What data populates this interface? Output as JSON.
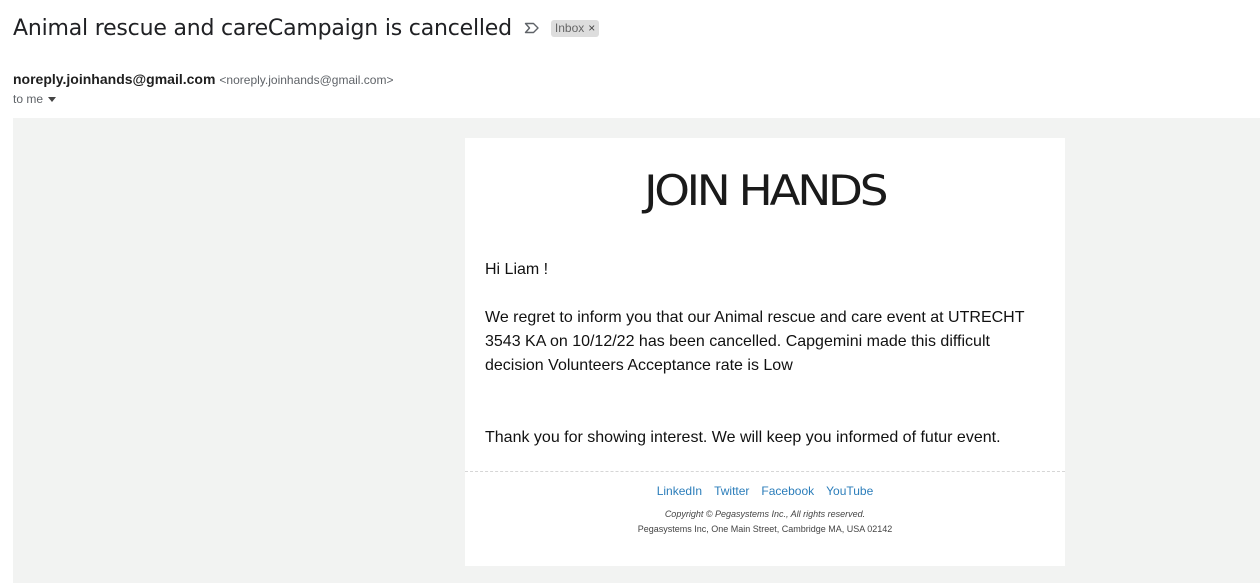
{
  "email": {
    "subject": "Animal rescue and careCampaign is cancelled",
    "label": "Inbox",
    "label_remove": "×",
    "sender_name": "noreply.joinhands@gmail.com",
    "sender_email": "<noreply.joinhands@gmail.com>",
    "recipient": "to me"
  },
  "content": {
    "logo_text": "JOIN HANDS",
    "greeting": "Hi Liam !",
    "paragraph": "We regret to inform you that our Animal rescue and care event at UTRECHT 3543 KA on 10/12/22 has been cancelled. Capgemini made this difficult decision Volunteers Acceptance rate is Low",
    "closing": "Thank you for showing interest. We will keep you informed of futur event."
  },
  "footer": {
    "links": [
      "LinkedIn",
      "Twitter",
      "Facebook",
      "YouTube"
    ],
    "copyright": "Copyright © Pegasystems Inc., All rights reserved.",
    "address": "Pegasystems Inc, One Main Street, Cambridge MA, USA 02142"
  },
  "colors": {
    "link": "#2b7dba",
    "background": "#f2f3f2"
  }
}
